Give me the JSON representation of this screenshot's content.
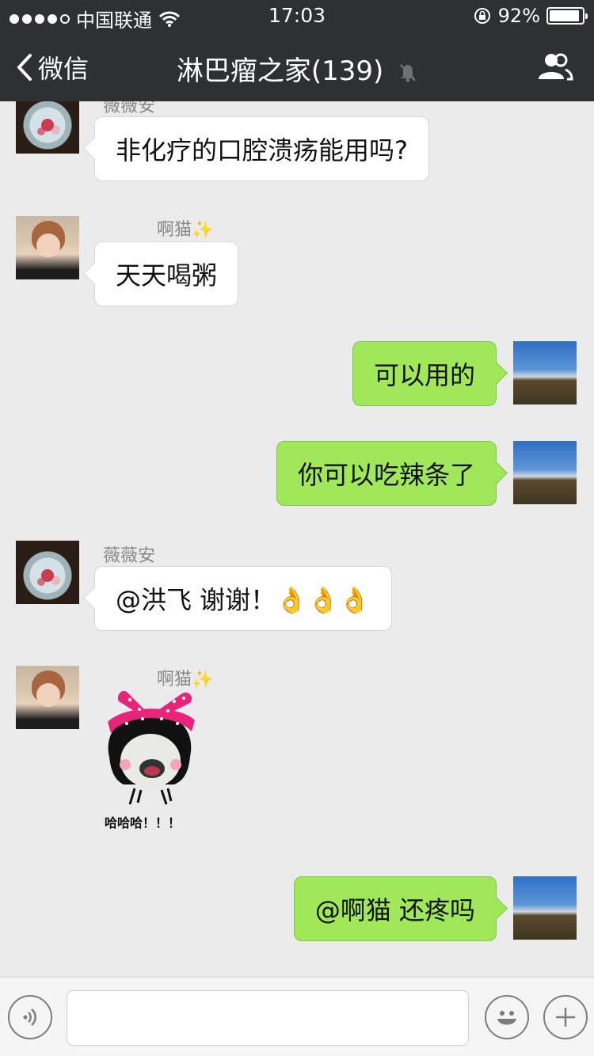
{
  "status_bar": {
    "carrier": "中国联通",
    "time": "17:03",
    "battery_percent": "92%",
    "battery_level": 0.92
  },
  "nav": {
    "back_label": "微信",
    "title": "淋巴瘤之家(139)"
  },
  "messages": [
    {
      "side": "in",
      "sender": "薇薇安",
      "text": "非化疗的口腔溃疡能用吗?"
    },
    {
      "side": "in",
      "sender": "啊猫✨",
      "text": "天天喝粥"
    },
    {
      "side": "out",
      "text": "可以用的"
    },
    {
      "side": "out",
      "text": "你可以吃辣条了"
    },
    {
      "side": "in",
      "sender": "薇薇安",
      "text": "@洪飞 谢谢！👌👌👌"
    },
    {
      "side": "in",
      "sender": "啊猫✨",
      "sticker_caption": "哈哈哈！！！"
    },
    {
      "side": "out",
      "text": "@啊猫 还疼吗"
    }
  ],
  "input": {
    "placeholder": ""
  },
  "colors": {
    "navbar_bg": "#2e3132",
    "chat_bg": "#ebebeb",
    "outgoing_bubble": "#a0e75a",
    "incoming_bubble": "#ffffff"
  }
}
